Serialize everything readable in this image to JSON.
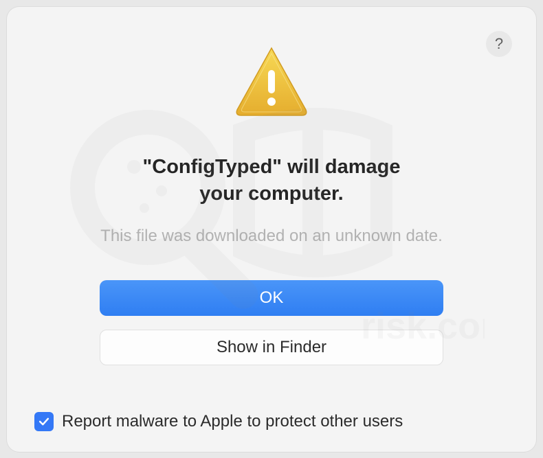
{
  "dialog": {
    "title_line1": "\"ConfigTyped\" will damage",
    "title_line2": "your computer.",
    "subtitle": "This file was downloaded on an unknown date.",
    "primary_button": "OK",
    "secondary_button": "Show in Finder",
    "help_label": "?",
    "checkbox_label": "Report malware to Apple to protect other users",
    "checkbox_checked": true
  }
}
